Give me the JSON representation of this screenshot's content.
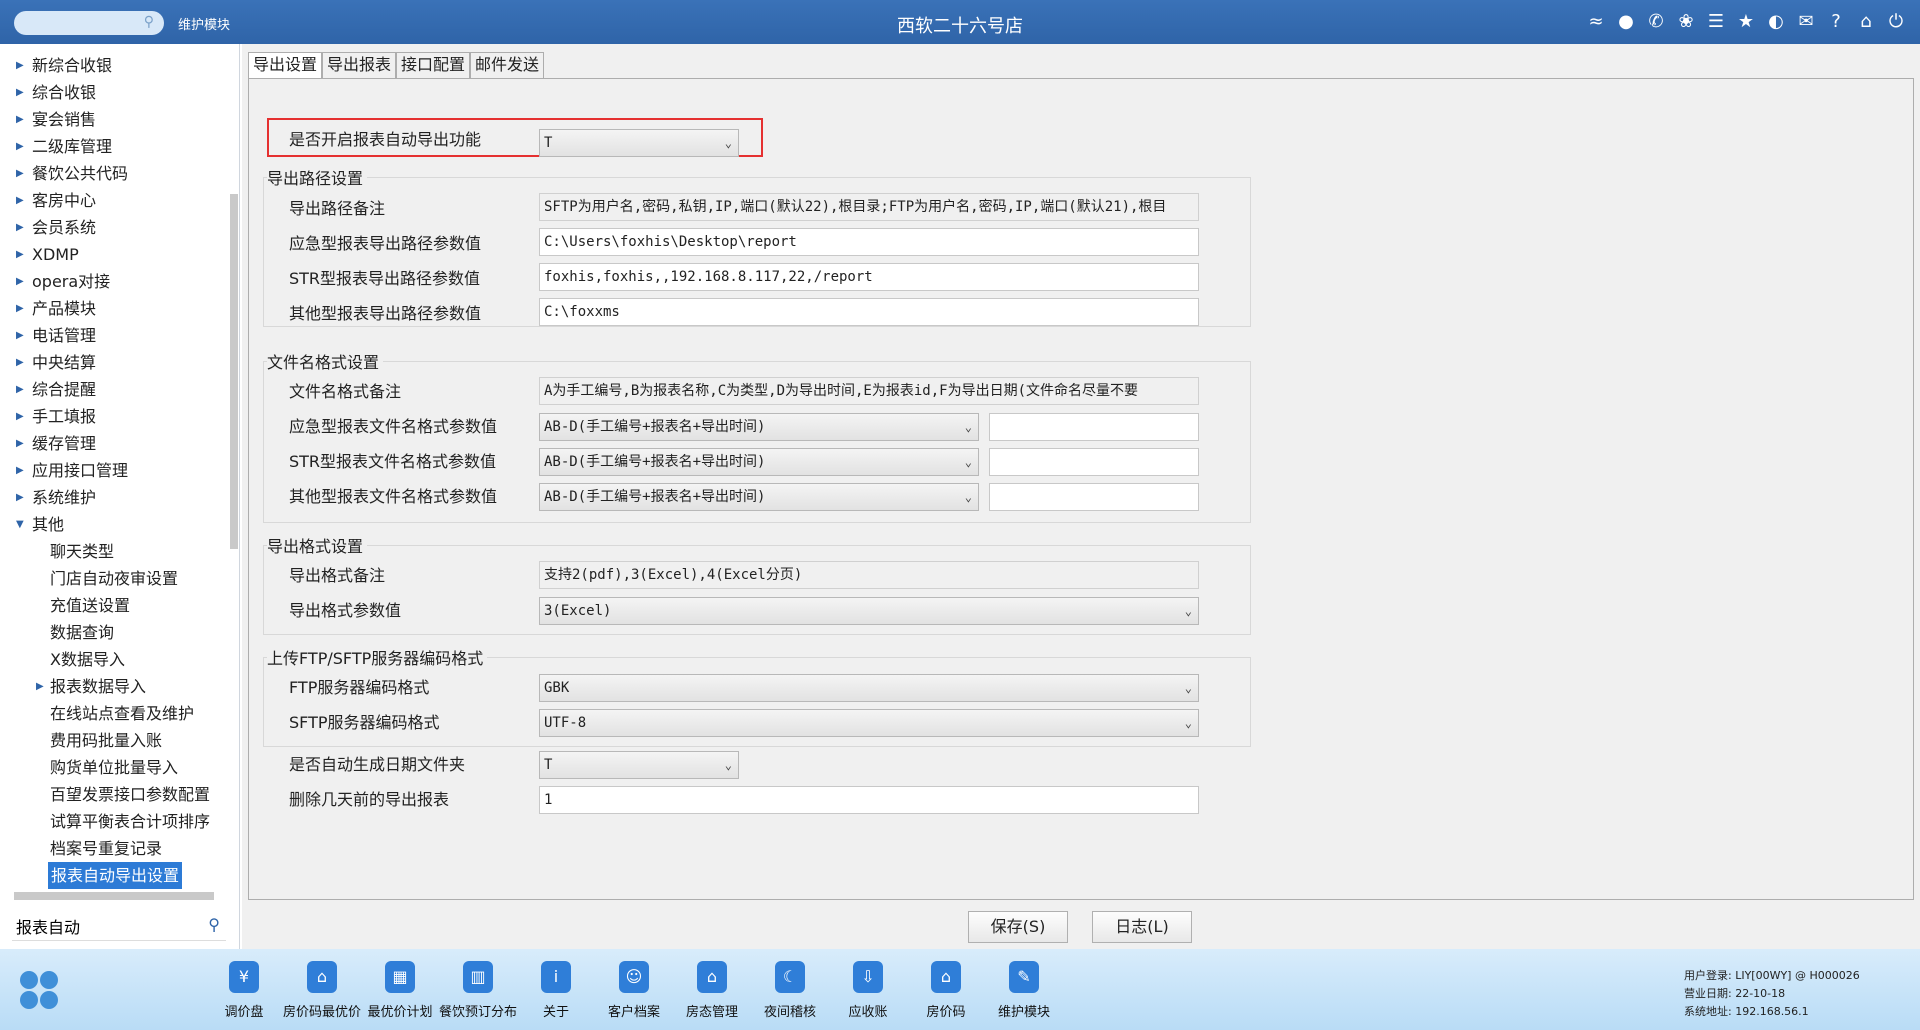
{
  "titlebar": {
    "module_label": "维护模块",
    "app_title": "西软二十六号店",
    "icons": [
      "wifi-icon",
      "chat-icon",
      "phone-icon",
      "palette-icon",
      "menu-icon",
      "star-icon",
      "contrast-icon",
      "mail-icon",
      "help-icon",
      "home-icon",
      "power-icon"
    ]
  },
  "sidebar": {
    "tree": [
      {
        "label": "新综合收银",
        "expandable": true
      },
      {
        "label": "综合收银",
        "expandable": true
      },
      {
        "label": "宴会销售",
        "expandable": true
      },
      {
        "label": "二级库管理",
        "expandable": true
      },
      {
        "label": "餐饮公共代码",
        "expandable": true
      },
      {
        "label": "客房中心",
        "expandable": true
      },
      {
        "label": "会员系统",
        "expandable": true
      },
      {
        "label": "XDMP",
        "expandable": true
      },
      {
        "label": "opera对接",
        "expandable": true
      },
      {
        "label": "产品模块",
        "expandable": true
      },
      {
        "label": "电话管理",
        "expandable": true
      },
      {
        "label": "中央结算",
        "expandable": true
      },
      {
        "label": "综合提醒",
        "expandable": true
      },
      {
        "label": "手工填报",
        "expandable": true
      },
      {
        "label": "缓存管理",
        "expandable": true
      },
      {
        "label": "应用接口管理",
        "expandable": true
      },
      {
        "label": "系统维护",
        "expandable": true
      },
      {
        "label": "其他",
        "expanded": true
      }
    ],
    "children": [
      {
        "label": "聊天类型"
      },
      {
        "label": "门店自动夜审设置"
      },
      {
        "label": "充值送设置"
      },
      {
        "label": "数据查询"
      },
      {
        "label": "X数据导入"
      },
      {
        "label": "报表数据导入",
        "expandable": true
      },
      {
        "label": "在线站点查看及维护"
      },
      {
        "label": "费用码批量入账"
      },
      {
        "label": "购货单位批量导入"
      },
      {
        "label": "百望发票接口参数配置"
      },
      {
        "label": "试算平衡表合计项排序"
      },
      {
        "label": "档案号重复记录"
      },
      {
        "label": "报表自动导出设置",
        "selected": true
      }
    ],
    "search_value": "报表自动"
  },
  "tabs": [
    "导出设置",
    "导出报表",
    "接口配置",
    "邮件发送"
  ],
  "form": {
    "auto_export_label": "是否开启报表自动导出功能",
    "auto_export_value": "T",
    "path_group": {
      "title": "导出路径设置",
      "remark_label": "导出路径备注",
      "remark_value": "SFTP为用户名,密码,私钥,IP,端口(默认22),根目录;FTP为用户名,密码,IP,端口(默认21),根目",
      "emergency_label": "应急型报表导出路径参数值",
      "emergency_value": "C:\\Users\\foxhis\\Desktop\\report",
      "str_label": "STR型报表导出路径参数值",
      "str_value": "foxhis,foxhis,,192.168.8.117,22,/report",
      "other_label": "其他型报表导出路径参数值",
      "other_value": "C:\\foxxms"
    },
    "filename_group": {
      "title": "文件名格式设置",
      "remark_label": "文件名格式备注",
      "remark_value": "A为手工编号,B为报表名称,C为类型,D为导出时间,E为报表id,F为导出日期(文件命名尽量不要",
      "emergency_label": "应急型报表文件名格式参数值",
      "emergency_value": "AB-D(手工编号+报表名+导出时间)",
      "str_label": "STR型报表文件名格式参数值",
      "str_value": "AB-D(手工编号+报表名+导出时间)",
      "other_label": "其他型报表文件名格式参数值",
      "other_value": "AB-D(手工编号+报表名+导出时间)"
    },
    "format_group": {
      "title": "导出格式设置",
      "remark_label": "导出格式备注",
      "remark_value": "支持2(pdf),3(Excel),4(Excel分页)",
      "value_label": "导出格式参数值",
      "value": "3(Excel)"
    },
    "encoding_group": {
      "title": "上传FTP/SFTP服务器编码格式",
      "ftp_label": "FTP服务器编码格式",
      "ftp_value": "GBK",
      "sftp_label": "SFTP服务器编码格式",
      "sftp_value": "UTF-8"
    },
    "date_folder_label": "是否自动生成日期文件夹",
    "date_folder_value": "T",
    "delete_days_label": "删除几天前的导出报表",
    "delete_days_value": "1"
  },
  "buttons": {
    "save": "保存(S)",
    "log": "日志(L)"
  },
  "taskbar": {
    "items": [
      {
        "label": "调价盘",
        "icon": "price-adjust-icon",
        "glyph": "¥"
      },
      {
        "label": "房价码最优价",
        "icon": "best-rate-icon",
        "glyph": "⌂"
      },
      {
        "label": "最优价计划",
        "icon": "rate-plan-icon",
        "glyph": "▦"
      },
      {
        "label": "餐饮预订分布",
        "icon": "dining-booking-icon",
        "glyph": "▥"
      },
      {
        "label": "关于",
        "icon": "info-icon",
        "glyph": "i"
      },
      {
        "label": "客户档案",
        "icon": "customer-profile-icon",
        "glyph": "☺"
      },
      {
        "label": "房态管理",
        "icon": "room-status-icon",
        "glyph": "⌂"
      },
      {
        "label": "夜间稽核",
        "icon": "night-audit-icon",
        "glyph": "☾"
      },
      {
        "label": "应收账",
        "icon": "receivable-icon",
        "glyph": "⇩"
      },
      {
        "label": "房价码",
        "icon": "rate-code-icon",
        "glyph": "⌂"
      },
      {
        "label": "维护模块",
        "icon": "maintenance-icon",
        "glyph": "✎"
      }
    ],
    "sysinfo": {
      "user": "用户登录:  LIY[00WY] @ H000026",
      "biz_date": "营业日期:  22-10-18",
      "sys_addr": "系统地址:  192.168.56.1"
    }
  }
}
